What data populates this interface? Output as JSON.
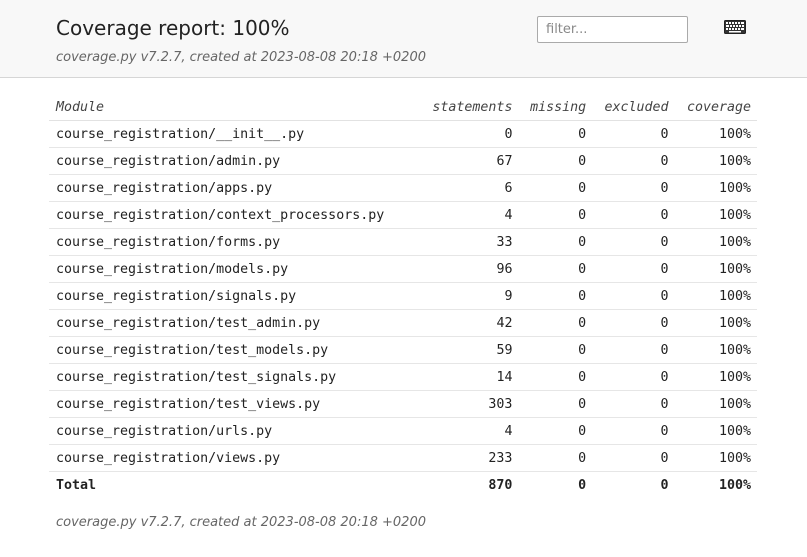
{
  "header": {
    "title": "Coverage report: 100%",
    "meta": "coverage.py v7.2.7, created at 2023-08-08 20:18 +0200",
    "filter_placeholder": "filter...",
    "keyboard_icon": "keyboard-icon"
  },
  "table": {
    "columns": [
      "Module",
      "statements",
      "missing",
      "excluded",
      "coverage"
    ],
    "rows": [
      [
        "course_registration/__init__.py",
        "0",
        "0",
        "0",
        "100%"
      ],
      [
        "course_registration/admin.py",
        "67",
        "0",
        "0",
        "100%"
      ],
      [
        "course_registration/apps.py",
        "6",
        "0",
        "0",
        "100%"
      ],
      [
        "course_registration/context_processors.py",
        "4",
        "0",
        "0",
        "100%"
      ],
      [
        "course_registration/forms.py",
        "33",
        "0",
        "0",
        "100%"
      ],
      [
        "course_registration/models.py",
        "96",
        "0",
        "0",
        "100%"
      ],
      [
        "course_registration/signals.py",
        "9",
        "0",
        "0",
        "100%"
      ],
      [
        "course_registration/test_admin.py",
        "42",
        "0",
        "0",
        "100%"
      ],
      [
        "course_registration/test_models.py",
        "59",
        "0",
        "0",
        "100%"
      ],
      [
        "course_registration/test_signals.py",
        "14",
        "0",
        "0",
        "100%"
      ],
      [
        "course_registration/test_views.py",
        "303",
        "0",
        "0",
        "100%"
      ],
      [
        "course_registration/urls.py",
        "4",
        "0",
        "0",
        "100%"
      ],
      [
        "course_registration/views.py",
        "233",
        "0",
        "0",
        "100%"
      ]
    ],
    "total": [
      "Total",
      "870",
      "0",
      "0",
      "100%"
    ]
  },
  "footer": {
    "meta": "coverage.py v7.2.7, created at 2023-08-08 20:18 +0200"
  }
}
